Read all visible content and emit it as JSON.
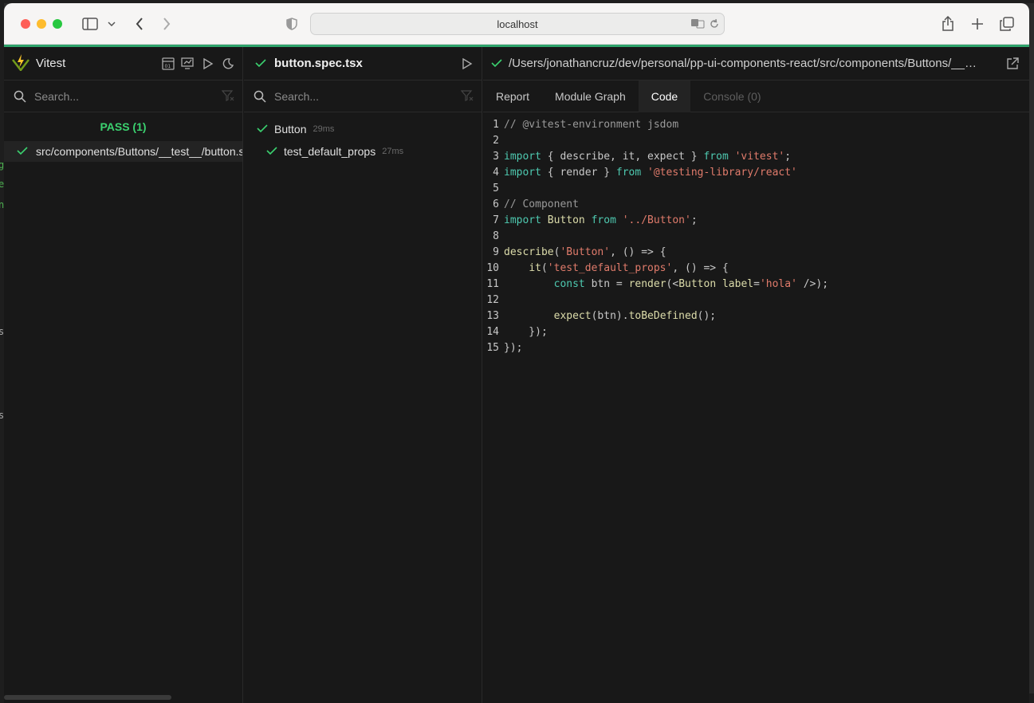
{
  "browser": {
    "url": "localhost"
  },
  "sidebar": {
    "app_name": "Vitest",
    "search_placeholder": "Search...",
    "status": "PASS (1)",
    "file": "src/components/Buttons/__test__/button.spec.tsx"
  },
  "tests": {
    "filename": "button.spec.tsx",
    "search_placeholder": "Search...",
    "items": [
      {
        "name": "Button",
        "duration": "29ms"
      },
      {
        "name": "test_default_props",
        "duration": "27ms"
      }
    ]
  },
  "detail": {
    "path": "/Users/jonathancruz/dev/personal/pp-ui-components-react/src/components/Buttons/__…",
    "tabs": {
      "report": "Report",
      "module_graph": "Module Graph",
      "code": "Code",
      "console": "Console (0)"
    },
    "code_lines": [
      "// @vitest-environment jsdom",
      "",
      "import { describe, it, expect } from 'vitest';",
      "import { render } from '@testing-library/react'",
      "",
      "// Component",
      "import Button from '../Button';",
      "",
      "describe('Button', () => {",
      "    it('test_default_props', () => {",
      "        const btn = render(<Button label='hola' />);",
      "",
      "        expect(btn).toBeDefined();",
      "    });",
      "});"
    ]
  },
  "colors": {
    "pass_green": "#3bd16f",
    "keyword": "#4ec9b0",
    "string": "#e07b6b",
    "function": "#dcdcaa",
    "comment": "#9a9a9a"
  }
}
